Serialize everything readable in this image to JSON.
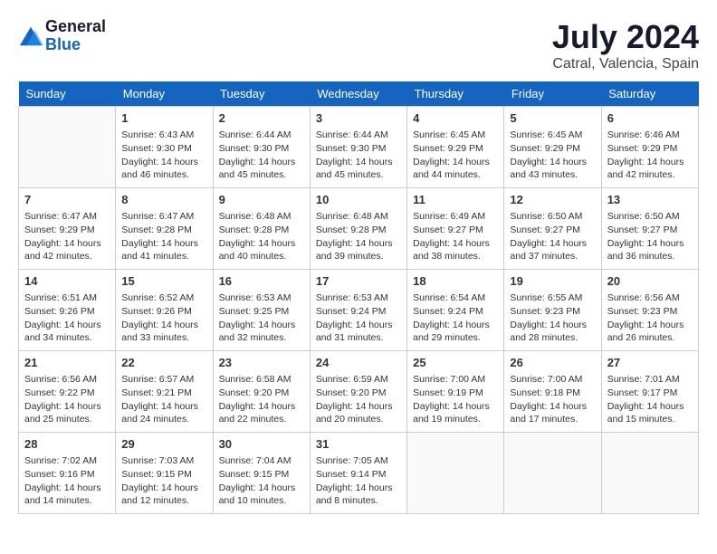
{
  "header": {
    "logo_line1": "General",
    "logo_line2": "Blue",
    "month_year": "July 2024",
    "location": "Catral, Valencia, Spain"
  },
  "weekdays": [
    "Sunday",
    "Monday",
    "Tuesday",
    "Wednesday",
    "Thursday",
    "Friday",
    "Saturday"
  ],
  "weeks": [
    [
      {
        "day": "",
        "sunrise": "",
        "sunset": "",
        "daylight": ""
      },
      {
        "day": "1",
        "sunrise": "Sunrise: 6:43 AM",
        "sunset": "Sunset: 9:30 PM",
        "daylight": "Daylight: 14 hours and 46 minutes."
      },
      {
        "day": "2",
        "sunrise": "Sunrise: 6:44 AM",
        "sunset": "Sunset: 9:30 PM",
        "daylight": "Daylight: 14 hours and 45 minutes."
      },
      {
        "day": "3",
        "sunrise": "Sunrise: 6:44 AM",
        "sunset": "Sunset: 9:30 PM",
        "daylight": "Daylight: 14 hours and 45 minutes."
      },
      {
        "day": "4",
        "sunrise": "Sunrise: 6:45 AM",
        "sunset": "Sunset: 9:29 PM",
        "daylight": "Daylight: 14 hours and 44 minutes."
      },
      {
        "day": "5",
        "sunrise": "Sunrise: 6:45 AM",
        "sunset": "Sunset: 9:29 PM",
        "daylight": "Daylight: 14 hours and 43 minutes."
      },
      {
        "day": "6",
        "sunrise": "Sunrise: 6:46 AM",
        "sunset": "Sunset: 9:29 PM",
        "daylight": "Daylight: 14 hours and 42 minutes."
      }
    ],
    [
      {
        "day": "7",
        "sunrise": "Sunrise: 6:47 AM",
        "sunset": "Sunset: 9:29 PM",
        "daylight": "Daylight: 14 hours and 42 minutes."
      },
      {
        "day": "8",
        "sunrise": "Sunrise: 6:47 AM",
        "sunset": "Sunset: 9:28 PM",
        "daylight": "Daylight: 14 hours and 41 minutes."
      },
      {
        "day": "9",
        "sunrise": "Sunrise: 6:48 AM",
        "sunset": "Sunset: 9:28 PM",
        "daylight": "Daylight: 14 hours and 40 minutes."
      },
      {
        "day": "10",
        "sunrise": "Sunrise: 6:48 AM",
        "sunset": "Sunset: 9:28 PM",
        "daylight": "Daylight: 14 hours and 39 minutes."
      },
      {
        "day": "11",
        "sunrise": "Sunrise: 6:49 AM",
        "sunset": "Sunset: 9:27 PM",
        "daylight": "Daylight: 14 hours and 38 minutes."
      },
      {
        "day": "12",
        "sunrise": "Sunrise: 6:50 AM",
        "sunset": "Sunset: 9:27 PM",
        "daylight": "Daylight: 14 hours and 37 minutes."
      },
      {
        "day": "13",
        "sunrise": "Sunrise: 6:50 AM",
        "sunset": "Sunset: 9:27 PM",
        "daylight": "Daylight: 14 hours and 36 minutes."
      }
    ],
    [
      {
        "day": "14",
        "sunrise": "Sunrise: 6:51 AM",
        "sunset": "Sunset: 9:26 PM",
        "daylight": "Daylight: 14 hours and 34 minutes."
      },
      {
        "day": "15",
        "sunrise": "Sunrise: 6:52 AM",
        "sunset": "Sunset: 9:26 PM",
        "daylight": "Daylight: 14 hours and 33 minutes."
      },
      {
        "day": "16",
        "sunrise": "Sunrise: 6:53 AM",
        "sunset": "Sunset: 9:25 PM",
        "daylight": "Daylight: 14 hours and 32 minutes."
      },
      {
        "day": "17",
        "sunrise": "Sunrise: 6:53 AM",
        "sunset": "Sunset: 9:24 PM",
        "daylight": "Daylight: 14 hours and 31 minutes."
      },
      {
        "day": "18",
        "sunrise": "Sunrise: 6:54 AM",
        "sunset": "Sunset: 9:24 PM",
        "daylight": "Daylight: 14 hours and 29 minutes."
      },
      {
        "day": "19",
        "sunrise": "Sunrise: 6:55 AM",
        "sunset": "Sunset: 9:23 PM",
        "daylight": "Daylight: 14 hours and 28 minutes."
      },
      {
        "day": "20",
        "sunrise": "Sunrise: 6:56 AM",
        "sunset": "Sunset: 9:23 PM",
        "daylight": "Daylight: 14 hours and 26 minutes."
      }
    ],
    [
      {
        "day": "21",
        "sunrise": "Sunrise: 6:56 AM",
        "sunset": "Sunset: 9:22 PM",
        "daylight": "Daylight: 14 hours and 25 minutes."
      },
      {
        "day": "22",
        "sunrise": "Sunrise: 6:57 AM",
        "sunset": "Sunset: 9:21 PM",
        "daylight": "Daylight: 14 hours and 24 minutes."
      },
      {
        "day": "23",
        "sunrise": "Sunrise: 6:58 AM",
        "sunset": "Sunset: 9:20 PM",
        "daylight": "Daylight: 14 hours and 22 minutes."
      },
      {
        "day": "24",
        "sunrise": "Sunrise: 6:59 AM",
        "sunset": "Sunset: 9:20 PM",
        "daylight": "Daylight: 14 hours and 20 minutes."
      },
      {
        "day": "25",
        "sunrise": "Sunrise: 7:00 AM",
        "sunset": "Sunset: 9:19 PM",
        "daylight": "Daylight: 14 hours and 19 minutes."
      },
      {
        "day": "26",
        "sunrise": "Sunrise: 7:00 AM",
        "sunset": "Sunset: 9:18 PM",
        "daylight": "Daylight: 14 hours and 17 minutes."
      },
      {
        "day": "27",
        "sunrise": "Sunrise: 7:01 AM",
        "sunset": "Sunset: 9:17 PM",
        "daylight": "Daylight: 14 hours and 15 minutes."
      }
    ],
    [
      {
        "day": "28",
        "sunrise": "Sunrise: 7:02 AM",
        "sunset": "Sunset: 9:16 PM",
        "daylight": "Daylight: 14 hours and 14 minutes."
      },
      {
        "day": "29",
        "sunrise": "Sunrise: 7:03 AM",
        "sunset": "Sunset: 9:15 PM",
        "daylight": "Daylight: 14 hours and 12 minutes."
      },
      {
        "day": "30",
        "sunrise": "Sunrise: 7:04 AM",
        "sunset": "Sunset: 9:15 PM",
        "daylight": "Daylight: 14 hours and 10 minutes."
      },
      {
        "day": "31",
        "sunrise": "Sunrise: 7:05 AM",
        "sunset": "Sunset: 9:14 PM",
        "daylight": "Daylight: 14 hours and 8 minutes."
      },
      {
        "day": "",
        "sunrise": "",
        "sunset": "",
        "daylight": ""
      },
      {
        "day": "",
        "sunrise": "",
        "sunset": "",
        "daylight": ""
      },
      {
        "day": "",
        "sunrise": "",
        "sunset": "",
        "daylight": ""
      }
    ]
  ]
}
